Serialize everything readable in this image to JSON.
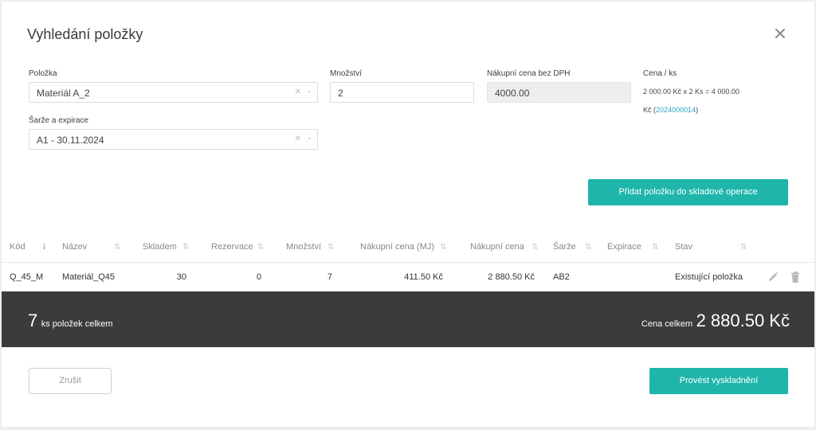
{
  "modal": {
    "title": "Vyhledání položky"
  },
  "form": {
    "item": {
      "label": "Položka",
      "value": "Materiál A_2"
    },
    "batch": {
      "label": "Šarže a expirace",
      "value": "A1 - 30.11.2024"
    },
    "quantity": {
      "label": "Množství",
      "value": "2"
    },
    "purchase_price": {
      "label": "Nákupní cena bez DPH",
      "value": "4000.00"
    },
    "unit_price": {
      "label": "Cena / ks",
      "calc": "2 000.00 Kč x 2 Ks = 4 000.00",
      "currency_prefix": "Kč (",
      "link": "2024000014",
      "suffix": ")"
    },
    "add_button": "Přidat položku do skladové operace"
  },
  "table": {
    "columns": [
      "Kód",
      "Název",
      "Skladem",
      "Rezervace",
      "Množství",
      "Nákupní cena (MJ)",
      "Nákupní cena",
      "Šarže",
      "Expirace",
      "Stav"
    ],
    "rows": [
      {
        "code": "Q_45_M",
        "name": "Materiál_Q45",
        "stock": "30",
        "reserved": "0",
        "qty": "7",
        "unit_price": "411.50 Kč",
        "price": "2 880.50 Kč",
        "batch": "AB2",
        "expiry": "",
        "state": "Existující položka"
      }
    ]
  },
  "summary": {
    "count": "7",
    "count_label": "ks položek celkem",
    "total_label": "Cena celkem",
    "total": "2 880.50 Kč"
  },
  "actions": {
    "cancel": "Zrušit",
    "submit": "Provést vyskladnění"
  },
  "colors": {
    "accent": "#1fb5ab",
    "footer_bg": "#3b3b3d",
    "link": "#2aa2c8"
  }
}
